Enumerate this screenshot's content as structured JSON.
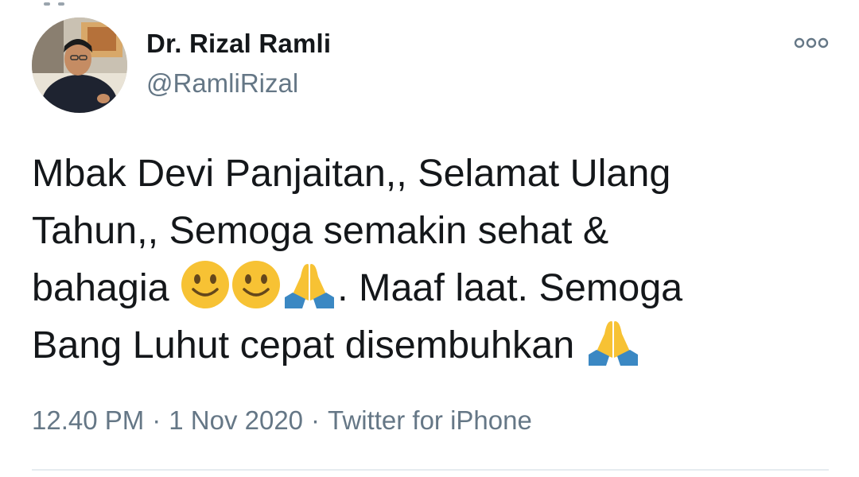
{
  "tweet": {
    "author": {
      "name": "Dr. Rizal Ramli",
      "handle": "@RamliRizal"
    },
    "text_parts": {
      "line1": "Mbak Devi Panjaitan,, Selamat Ulang",
      "line2": "Tahun,, Semoga semakin sehat &",
      "line3_start": "bahagia",
      "line3_mid": ".  Maaf laat. Semoga",
      "line4": "Bang Luhut cepat disembuhkan"
    },
    "emoji_icons": [
      "slightly-smiling-face-icon",
      "slightly-smiling-face-icon",
      "folded-hands-icon",
      "folded-hands-icon"
    ],
    "time": "12.40 PM",
    "date": "1 Nov 2020",
    "separator": "·",
    "source": "Twitter for iPhone",
    "more_icon": "more-dots-icon"
  },
  "colors": {
    "text": "#14171a",
    "secondary": "#657786",
    "divider": "#e6ecf0",
    "emoji_face": "#f7c234",
    "emoji_hands": "#f7c234",
    "emoji_sleeve": "#3b88c3"
  }
}
